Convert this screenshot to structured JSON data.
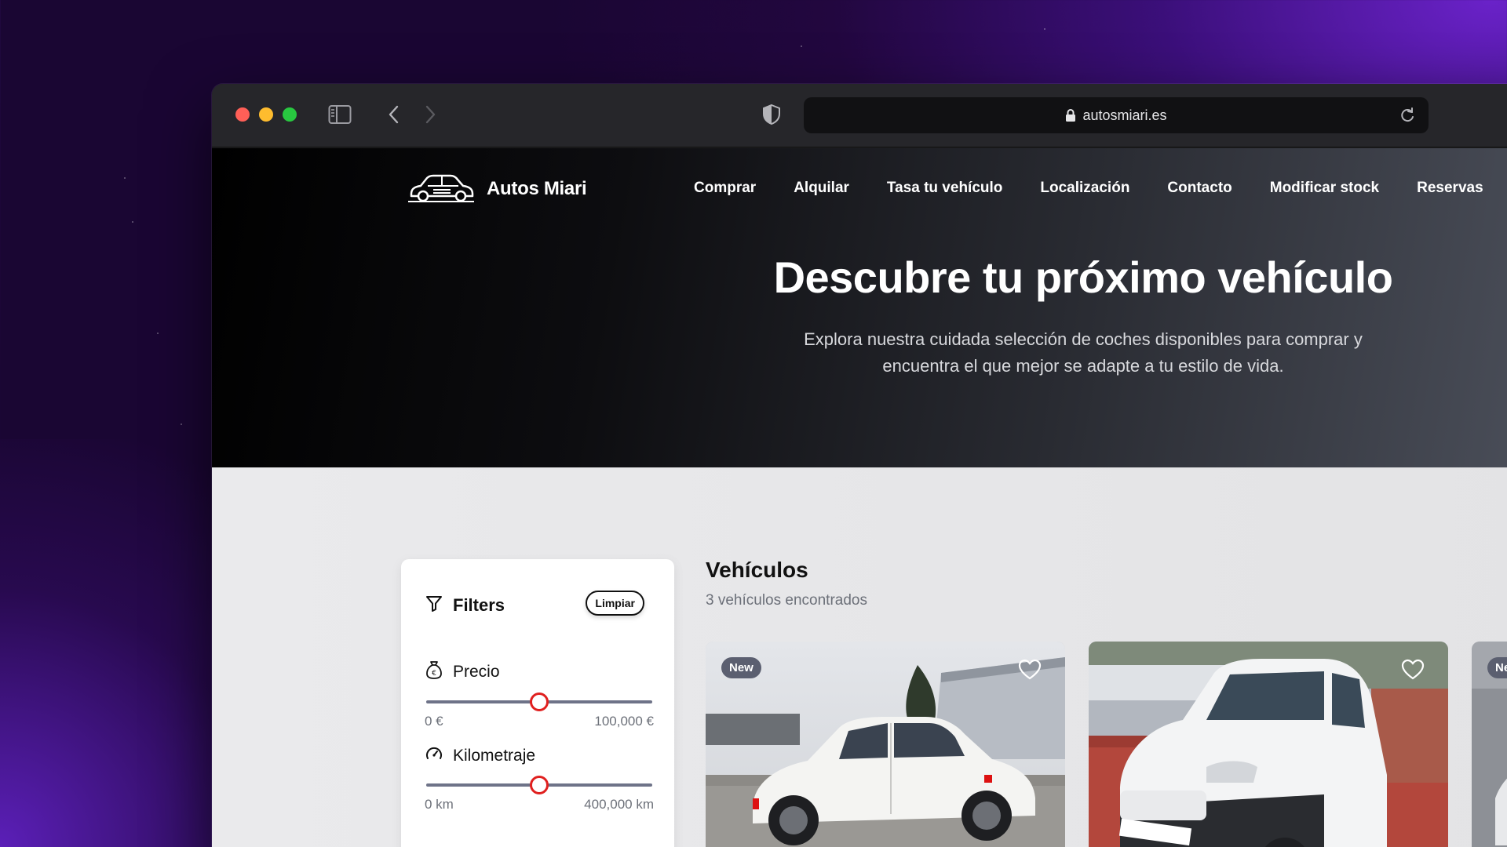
{
  "browser": {
    "url": "autosmiari.es"
  },
  "site": {
    "brand": "Autos Miari",
    "nav": [
      "Comprar",
      "Alquilar",
      "Tasa tu vehículo",
      "Localización",
      "Contacto",
      "Modificar stock",
      "Reservas"
    ]
  },
  "hero": {
    "title": "Descubre tu próximo vehículo",
    "subtitle": "Explora nuestra cuidada selección de coches disponibles para comprar y encuentra el que mejor se adapte a tu estilo de vida."
  },
  "filters": {
    "title": "Filters",
    "clear_label": "Limpiar",
    "price": {
      "label": "Precio",
      "min": "0 €",
      "max": "100,000 €",
      "level": 0.5
    },
    "mileage": {
      "label": "Kilometraje",
      "min": "0 km",
      "max": "400,000 km",
      "level": 0.5
    }
  },
  "listing": {
    "title": "Vehículos",
    "count": "3 vehículos encontrados",
    "cards": [
      {
        "badge": "New",
        "vehicle": "white-compact-car"
      },
      {
        "badge": "",
        "vehicle": "white-van"
      },
      {
        "badge": "Ne",
        "vehicle": "car"
      }
    ]
  },
  "colors": {
    "accent": "#e0201f",
    "badge": "#5b5f70"
  }
}
